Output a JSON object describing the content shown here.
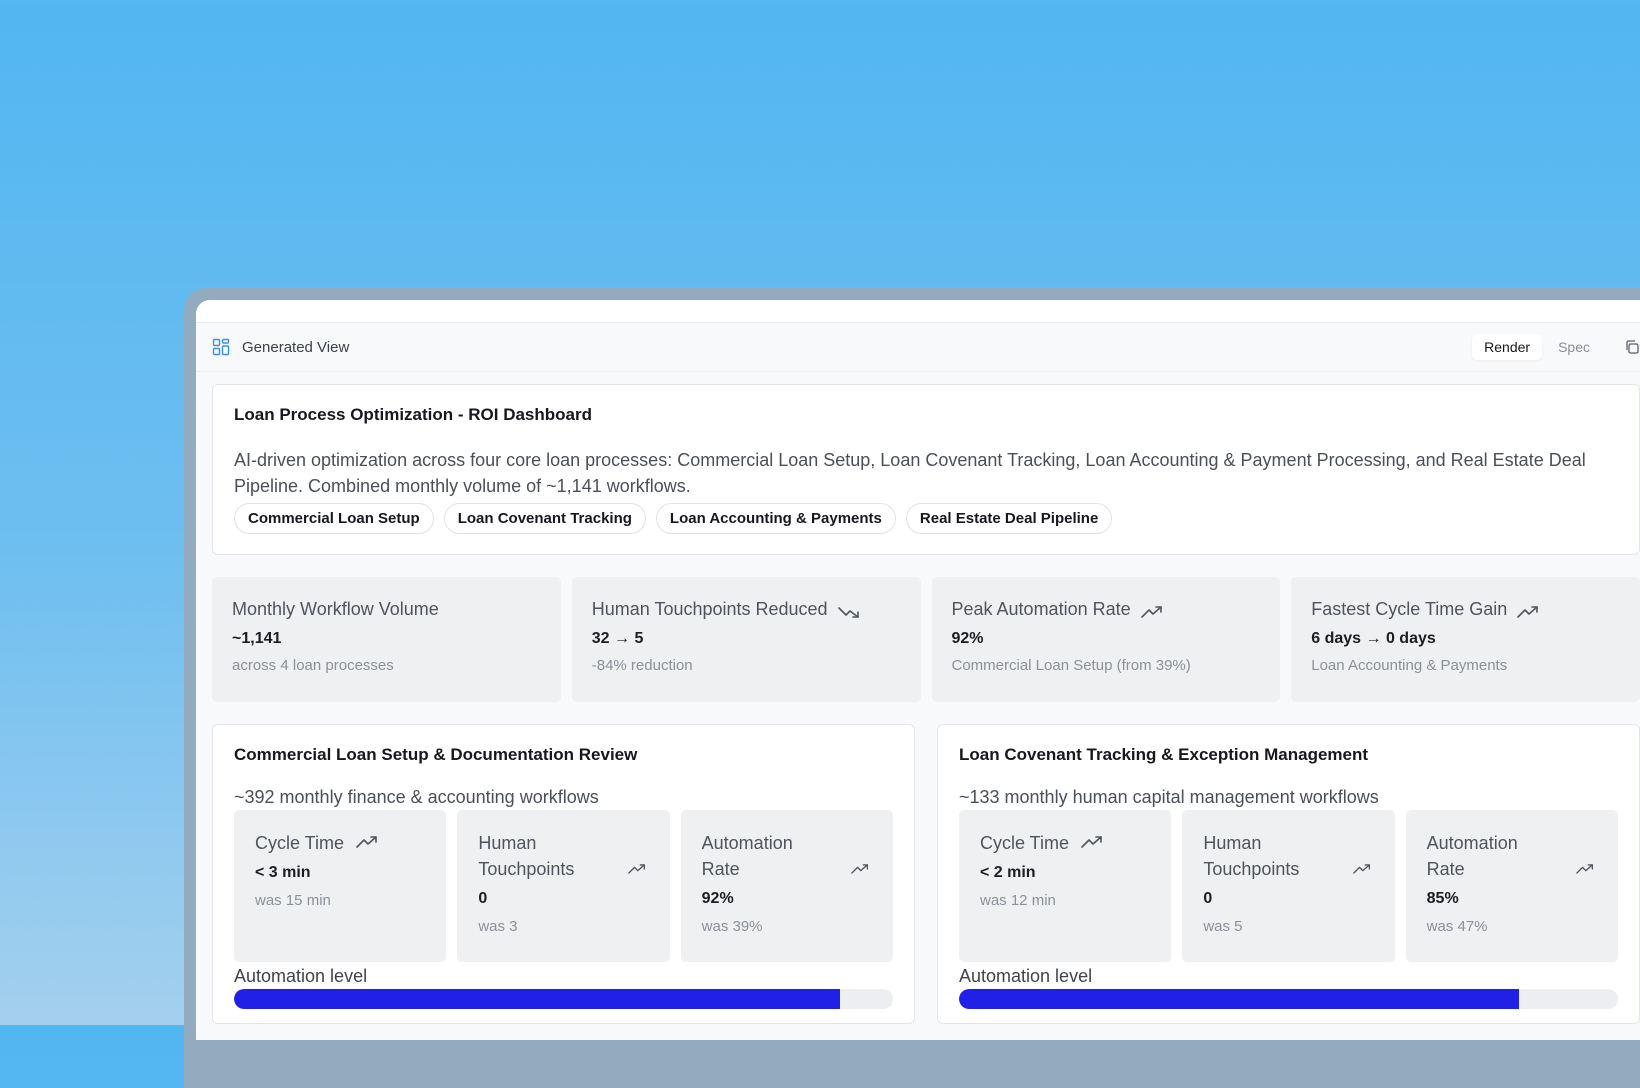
{
  "viewbar": {
    "title": "Generated View",
    "icon": "layout-grid-icon",
    "modes": [
      "Render",
      "Spec"
    ],
    "active_mode": "Render",
    "copy_icon": "copy-icon"
  },
  "header": {
    "title": "Loan Process Optimization - ROI Dashboard",
    "description": "AI-driven optimization across four core loan processes: Commercial Loan Setup, Loan Covenant Tracking, Loan Accounting & Payment Processing, and Real Estate Deal Pipeline. Combined monthly volume of ~1,141 workflows.",
    "tags": [
      "Commercial Loan Setup",
      "Loan Covenant Tracking",
      "Loan Accounting & Payments",
      "Real Estate Deal Pipeline"
    ]
  },
  "kpis": [
    {
      "label": "Monthly Workflow Volume",
      "value": "~1,141",
      "sub": "across 4 loan processes",
      "trend": ""
    },
    {
      "label": "Human Touchpoints Reduced",
      "value": "32 → 5",
      "sub": "-84% reduction",
      "trend": "trending-down-icon"
    },
    {
      "label": "Peak Automation Rate",
      "value": "92%",
      "sub": "Commercial Loan Setup (from 39%)",
      "trend": "trending-up-icon"
    },
    {
      "label": "Fastest Cycle Time Gain",
      "value": "6 days → 0 days",
      "sub": "Loan Accounting & Payments",
      "trend": "trending-up-icon"
    }
  ],
  "panels": [
    {
      "title": "Commercial Loan Setup & Documentation Review",
      "subtitle": "~392 monthly finance & accounting workflows",
      "metrics": [
        {
          "label": "Cycle Time",
          "value": "< 3 min",
          "sub": "was 15 min"
        },
        {
          "label": "Human Touchpoints",
          "value": "0",
          "sub": "was 3"
        },
        {
          "label": "Automation Rate",
          "value": "92%",
          "sub": "was 39%"
        }
      ],
      "automation_label": "Automation level",
      "automation_level": 0.92
    },
    {
      "title": "Loan Covenant Tracking & Exception Management",
      "subtitle": "~133 monthly human capital management workflows",
      "metrics": [
        {
          "label": "Cycle Time",
          "value": "< 2 min",
          "sub": "was 12 min"
        },
        {
          "label": "Human Touchpoints",
          "value": "0",
          "sub": "was 5"
        },
        {
          "label": "Automation Rate",
          "value": "85%",
          "sub": "was 47%"
        }
      ],
      "automation_label": "Automation level",
      "automation_level": 0.85
    }
  ],
  "colors": {
    "accent_bar": "#2020e6",
    "icon_blue": "#3d8fe0"
  }
}
